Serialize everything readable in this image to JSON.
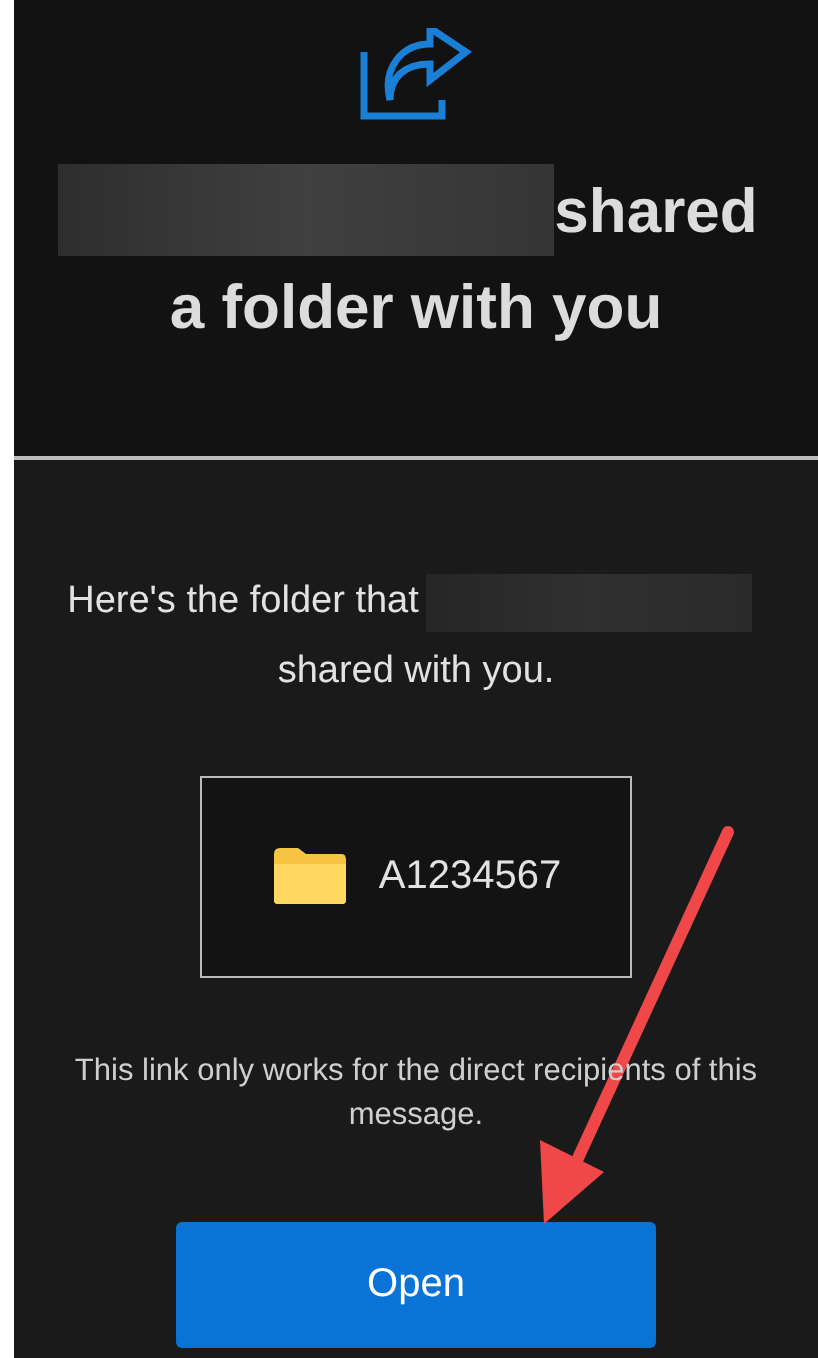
{
  "header": {
    "title_line_1": "shared",
    "title_line_2": "a folder with you"
  },
  "message": {
    "line_1": "Here's the folder that",
    "line_2": "shared with you."
  },
  "folder": {
    "name": "A1234567"
  },
  "notice": "This link only works for the direct recipients of this message.",
  "button": {
    "label": "Open"
  }
}
